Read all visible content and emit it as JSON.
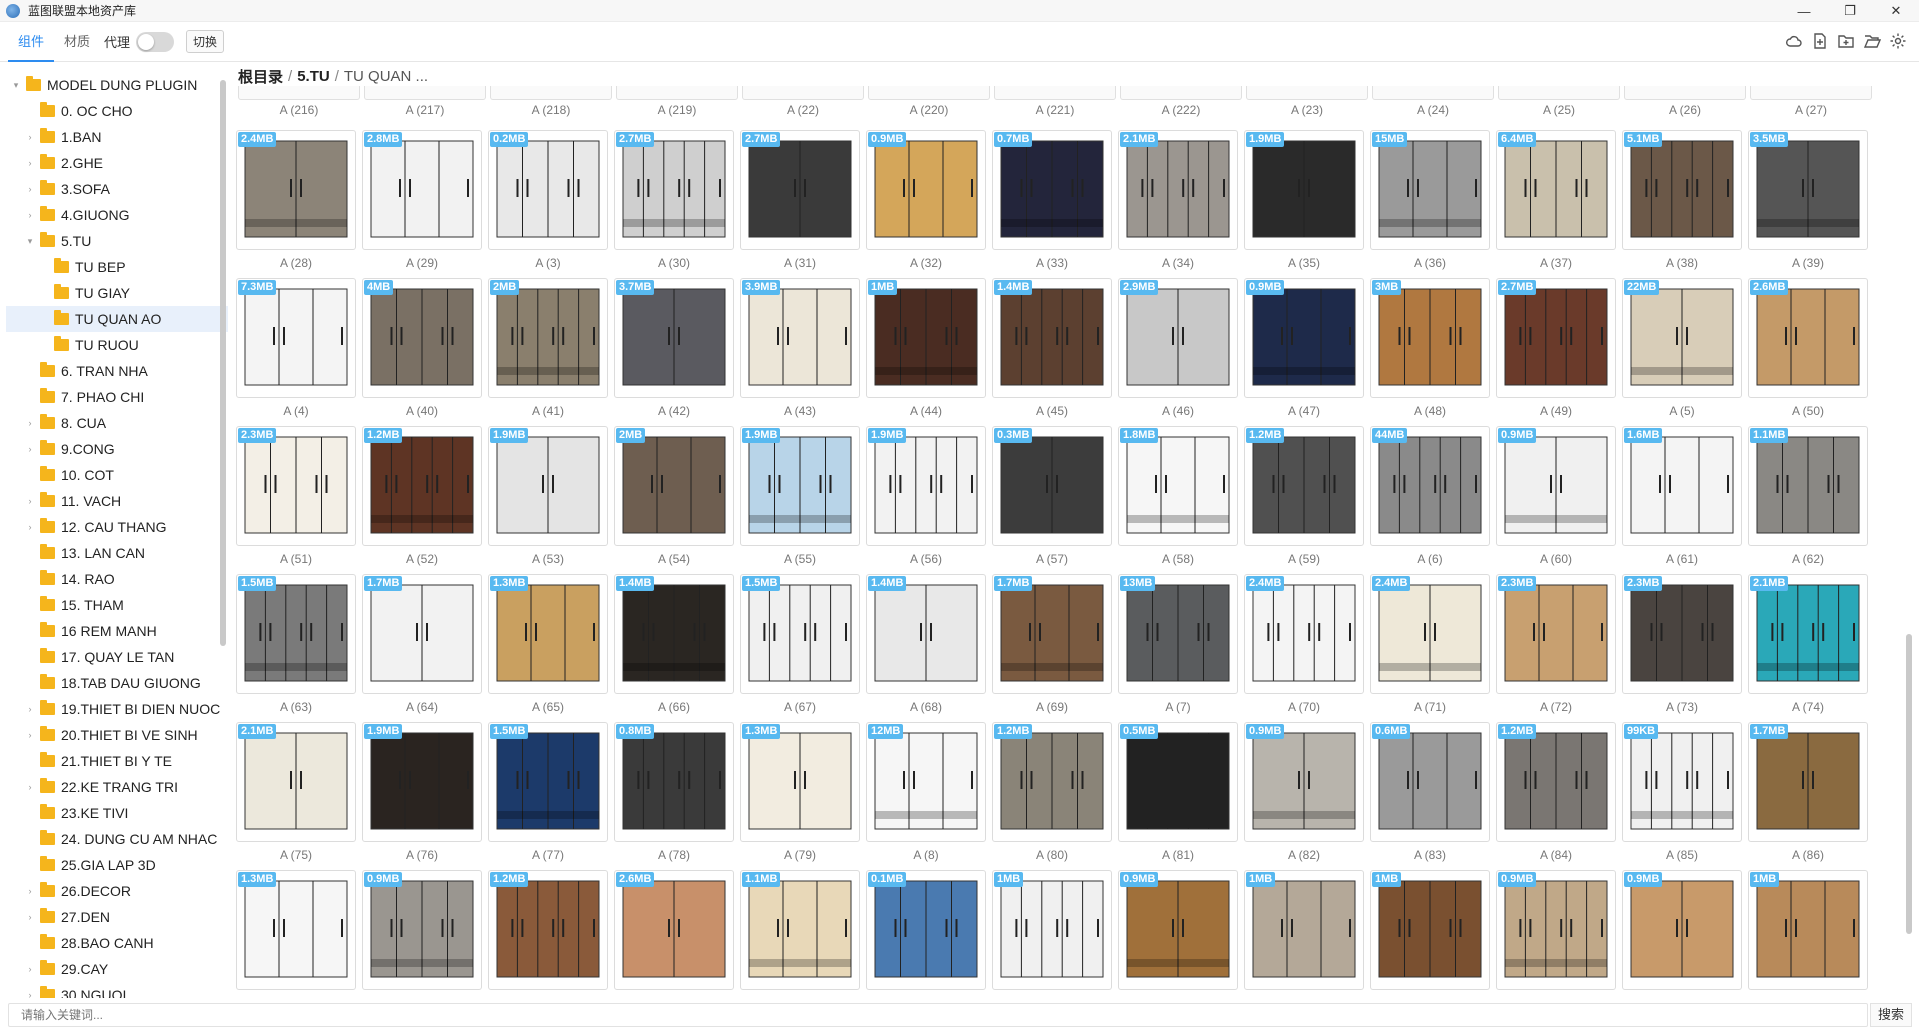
{
  "window": {
    "title": "蓝图联盟本地资产库",
    "min_glyph": "—",
    "max_glyph": "❐",
    "close_glyph": "✕"
  },
  "toolbar": {
    "tabs": [
      {
        "label": "组件",
        "active": true
      },
      {
        "label": "材质",
        "active": false
      }
    ],
    "proxy_label": "代理",
    "proxy_on": false,
    "switch_label": "切换",
    "icons": [
      "cloud-icon",
      "new-file-icon",
      "new-folder-icon",
      "open-folder-icon",
      "settings-icon"
    ]
  },
  "tree": [
    {
      "label": "MODEL DUNG PLUGIN",
      "level": 0,
      "caret": "▾"
    },
    {
      "label": "0. OC CHO",
      "level": 1,
      "caret": ""
    },
    {
      "label": "1.BAN",
      "level": 1,
      "caret": "›"
    },
    {
      "label": "2.GHE",
      "level": 1,
      "caret": "›"
    },
    {
      "label": "3.SOFA",
      "level": 1,
      "caret": "›"
    },
    {
      "label": "4.GIUONG",
      "level": 1,
      "caret": "›"
    },
    {
      "label": "5.TU",
      "level": 1,
      "caret": "▾"
    },
    {
      "label": "TU BEP",
      "level": 2,
      "caret": ""
    },
    {
      "label": "TU GIAY",
      "level": 2,
      "caret": ""
    },
    {
      "label": "TU QUAN AO",
      "level": 2,
      "caret": "",
      "selected": true
    },
    {
      "label": "TU RUOU",
      "level": 2,
      "caret": ""
    },
    {
      "label": "6. TRAN NHA",
      "level": 1,
      "caret": ""
    },
    {
      "label": "7. PHAO CHI",
      "level": 1,
      "caret": ""
    },
    {
      "label": "8. CUA",
      "level": 1,
      "caret": "›"
    },
    {
      "label": "9.CONG",
      "level": 1,
      "caret": "›"
    },
    {
      "label": "10. COT",
      "level": 1,
      "caret": ""
    },
    {
      "label": "11. VACH",
      "level": 1,
      "caret": "›"
    },
    {
      "label": "12. CAU THANG",
      "level": 1,
      "caret": "›"
    },
    {
      "label": "13. LAN CAN",
      "level": 1,
      "caret": ""
    },
    {
      "label": "14. RAO",
      "level": 1,
      "caret": ""
    },
    {
      "label": "15. THAM",
      "level": 1,
      "caret": ""
    },
    {
      "label": "16 REM MANH",
      "level": 1,
      "caret": ""
    },
    {
      "label": "17. QUAY LE TAN",
      "level": 1,
      "caret": ""
    },
    {
      "label": "18.TAB DAU GIUONG",
      "level": 1,
      "caret": ""
    },
    {
      "label": "19.THIET BI DIEN NUOC",
      "level": 1,
      "caret": "›"
    },
    {
      "label": "20.THIET BI VE SINH",
      "level": 1,
      "caret": "›"
    },
    {
      "label": "21.THIET BI Y TE",
      "level": 1,
      "caret": ""
    },
    {
      "label": "22.KE TRANG TRI",
      "level": 1,
      "caret": "›"
    },
    {
      "label": "23.KE TIVI",
      "level": 1,
      "caret": ""
    },
    {
      "label": "24. DUNG CU AM NHAC",
      "level": 1,
      "caret": ""
    },
    {
      "label": "25.GIA LAP 3D",
      "level": 1,
      "caret": ""
    },
    {
      "label": "26.DECOR",
      "level": 1,
      "caret": "›"
    },
    {
      "label": "27.DEN",
      "level": 1,
      "caret": "›"
    },
    {
      "label": "28.BAO CANH",
      "level": 1,
      "caret": ""
    },
    {
      "label": "29.CAY",
      "level": 1,
      "caret": "›"
    },
    {
      "label": "30.NGUOI",
      "level": 1,
      "caret": "›"
    }
  ],
  "breadcrumb": {
    "root": "根目录",
    "sep": "/",
    "folder": "5.TU",
    "current": "TU QUAN ..."
  },
  "top_row": [
    "A (216)",
    "A (217)",
    "A (218)",
    "A (219)",
    "A (22)",
    "A (220)",
    "A (221)",
    "A (222)",
    "A (23)",
    "A (24)",
    "A (25)",
    "A (26)",
    "A (27)"
  ],
  "assets": [
    {
      "name": "A (28)",
      "size": "2.4MB",
      "c": "#8c8478"
    },
    {
      "name": "A (29)",
      "size": "2.8MB",
      "c": "#f2f2f2"
    },
    {
      "name": "A (3)",
      "size": "0.2MB",
      "c": "#e8e8e8"
    },
    {
      "name": "A (30)",
      "size": "2.7MB",
      "c": "#cfcfcf"
    },
    {
      "name": "A (31)",
      "size": "2.7MB",
      "c": "#3a3a3a"
    },
    {
      "name": "A (32)",
      "size": "0.9MB",
      "c": "#d4a65a"
    },
    {
      "name": "A (33)",
      "size": "0.7MB",
      "c": "#23253b"
    },
    {
      "name": "A (34)",
      "size": "2.1MB",
      "c": "#9b9690"
    },
    {
      "name": "A (35)",
      "size": "1.9MB",
      "c": "#2a2a2a"
    },
    {
      "name": "A (36)",
      "size": "15MB",
      "c": "#9a9a9a"
    },
    {
      "name": "A (37)",
      "size": "6.4MB",
      "c": "#c9c0ac"
    },
    {
      "name": "A (38)",
      "size": "5.1MB",
      "c": "#6b5848"
    },
    {
      "name": "A (39)",
      "size": "3.5MB",
      "c": "#555555"
    },
    {
      "name": "A (4)",
      "size": "7.3MB",
      "c": "#f4f4f4"
    },
    {
      "name": "A (40)",
      "size": "4MB",
      "c": "#7a7064"
    },
    {
      "name": "A (41)",
      "size": "2MB",
      "c": "#8a7f6d"
    },
    {
      "name": "A (42)",
      "size": "3.7MB",
      "c": "#5a5a60"
    },
    {
      "name": "A (43)",
      "size": "3.9MB",
      "c": "#ece6d8"
    },
    {
      "name": "A (44)",
      "size": "1MB",
      "c": "#4a2c22"
    },
    {
      "name": "A (45)",
      "size": "1.4MB",
      "c": "#5c4030"
    },
    {
      "name": "A (46)",
      "size": "2.9MB",
      "c": "#c8c8c8"
    },
    {
      "name": "A (47)",
      "size": "0.9MB",
      "c": "#1e2a4a"
    },
    {
      "name": "A (48)",
      "size": "3MB",
      "c": "#b07840"
    },
    {
      "name": "A (49)",
      "size": "2.7MB",
      "c": "#6a3a2a"
    },
    {
      "name": "A (5)",
      "size": "22MB",
      "c": "#d8cdb8"
    },
    {
      "name": "A (50)",
      "size": "2.6MB",
      "c": "#c49a68"
    },
    {
      "name": "A (51)",
      "size": "2.3MB",
      "c": "#f3efe6"
    },
    {
      "name": "A (52)",
      "size": "1.2MB",
      "c": "#5e3424"
    },
    {
      "name": "A (53)",
      "size": "1.9MB",
      "c": "#e4e4e4"
    },
    {
      "name": "A (54)",
      "size": "2MB",
      "c": "#6e5e50"
    },
    {
      "name": "A (55)",
      "size": "1.9MB",
      "c": "#b8d4e8"
    },
    {
      "name": "A (56)",
      "size": "1.9MB",
      "c": "#f2f2f2"
    },
    {
      "name": "A (57)",
      "size": "0.3MB",
      "c": "#3c3c3c"
    },
    {
      "name": "A (58)",
      "size": "1.8MB",
      "c": "#f6f6f6"
    },
    {
      "name": "A (59)",
      "size": "1.2MB",
      "c": "#505050"
    },
    {
      "name": "A (6)",
      "size": "44MB",
      "c": "#8a8a8a"
    },
    {
      "name": "A (60)",
      "size": "0.9MB",
      "c": "#f0f0f0"
    },
    {
      "name": "A (61)",
      "size": "1.6MB",
      "c": "#f4f4f4"
    },
    {
      "name": "A (62)",
      "size": "1.1MB",
      "c": "#8a8884"
    },
    {
      "name": "A (63)",
      "size": "1.5MB",
      "c": "#7a7a7a"
    },
    {
      "name": "A (64)",
      "size": "1.7MB",
      "c": "#f2f2f2"
    },
    {
      "name": "A (65)",
      "size": "1.3MB",
      "c": "#c9a060"
    },
    {
      "name": "A (66)",
      "size": "1.4MB",
      "c": "#2a2622"
    },
    {
      "name": "A (67)",
      "size": "1.5MB",
      "c": "#f0f0f0"
    },
    {
      "name": "A (68)",
      "size": "1.4MB",
      "c": "#e8e8e8"
    },
    {
      "name": "A (69)",
      "size": "1.7MB",
      "c": "#7a5a40"
    },
    {
      "name": "A (7)",
      "size": "13MB",
      "c": "#5a5c5e"
    },
    {
      "name": "A (70)",
      "size": "2.4MB",
      "c": "#f4f4f4"
    },
    {
      "name": "A (71)",
      "size": "2.4MB",
      "c": "#eee8d8"
    },
    {
      "name": "A (72)",
      "size": "2.3MB",
      "c": "#c8a070"
    },
    {
      "name": "A (73)",
      "size": "2.3MB",
      "c": "#4a4440"
    },
    {
      "name": "A (74)",
      "size": "2.1MB",
      "c": "#2aa8b8"
    },
    {
      "name": "A (75)",
      "size": "2.1MB",
      "c": "#ece8dc"
    },
    {
      "name": "A (76)",
      "size": "1.9MB",
      "c": "#2a2420"
    },
    {
      "name": "A (77)",
      "size": "1.5MB",
      "c": "#1c3a6a"
    },
    {
      "name": "A (78)",
      "size": "0.8MB",
      "c": "#3a3a3a"
    },
    {
      "name": "A (79)",
      "size": "1.3MB",
      "c": "#f2ece0"
    },
    {
      "name": "A (8)",
      "size": "12MB",
      "c": "#f6f6f6"
    },
    {
      "name": "A (80)",
      "size": "1.2MB",
      "c": "#8a8478"
    },
    {
      "name": "A (81)",
      "size": "0.5MB",
      "c": "#222222"
    },
    {
      "name": "A (82)",
      "size": "0.9MB",
      "c": "#b8b4ac"
    },
    {
      "name": "A (83)",
      "size": "0.6MB",
      "c": "#9a9a9a"
    },
    {
      "name": "A (84)",
      "size": "1.2MB",
      "c": "#7a7672"
    },
    {
      "name": "A (85)",
      "size": "99KB",
      "c": "#f0f0f0"
    },
    {
      "name": "A (86)",
      "size": "1.7MB",
      "c": "#8a6a40"
    },
    {
      "name": "",
      "size": "1.3MB",
      "c": "#f6f6f6"
    },
    {
      "name": "",
      "size": "0.9MB",
      "c": "#9a9690"
    },
    {
      "name": "",
      "size": "1.2MB",
      "c": "#8a5a3a"
    },
    {
      "name": "",
      "size": "2.6MB",
      "c": "#c8906a"
    },
    {
      "name": "",
      "size": "1.1MB",
      "c": "#e8d8b8"
    },
    {
      "name": "",
      "size": "0.1MB",
      "c": "#4a7ab0"
    },
    {
      "name": "",
      "size": "1MB",
      "c": "#f0f0f0"
    },
    {
      "name": "",
      "size": "0.9MB",
      "c": "#a0703a"
    },
    {
      "name": "",
      "size": "1MB",
      "c": "#b4a898"
    },
    {
      "name": "",
      "size": "1MB",
      "c": "#7a5030"
    },
    {
      "name": "",
      "size": "0.9MB",
      "c": "#c0a888"
    },
    {
      "name": "",
      "size": "0.9MB",
      "c": "#c89a6a"
    },
    {
      "name": "",
      "size": "1MB",
      "c": "#b88a5a"
    }
  ],
  "search": {
    "placeholder": "请输入关键词...",
    "button": "搜索"
  }
}
